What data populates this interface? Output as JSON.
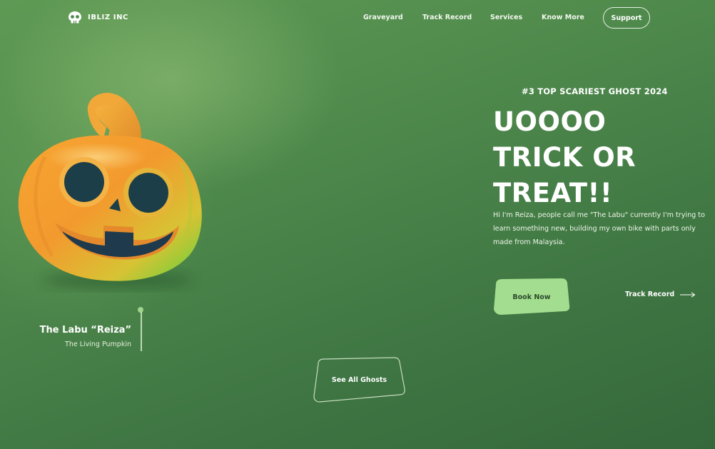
{
  "brand": {
    "name": "IBLIZ INC",
    "logo_icon": "skull-icon"
  },
  "nav": {
    "items": [
      {
        "label": "Graveyard"
      },
      {
        "label": "Track Record"
      },
      {
        "label": "Services"
      },
      {
        "label": "Know More"
      }
    ],
    "support_label": "Support"
  },
  "hero": {
    "eyebrow": "#3 TOP SCARIEST GHOST 2024",
    "headline": [
      "UOOOO",
      "TRICK OR",
      "TREAT!!"
    ],
    "description": "Hi I'm Reiza, people call me \"The Labu\" currently I'm trying to learn something new, building my own bike with parts only made from Malaysia.",
    "book_label": "Book Now",
    "track_label": "Track Record",
    "track_icon": "arrow-right-icon"
  },
  "character": {
    "name": "The Labu “Reiza”",
    "role": "The Living Pumpkin",
    "image_icon": "jack-o-lantern-icon"
  },
  "see_all_label": "See All Ghosts",
  "colors": {
    "accent_green": "#a3dd8f",
    "background": "#4f8a4c"
  }
}
